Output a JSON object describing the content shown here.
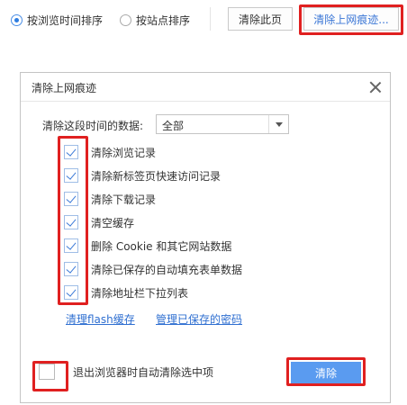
{
  "toolbar": {
    "sort_by_time": "按浏览时间排序",
    "sort_by_site": "按站点排序",
    "clear_page_button": "清除此页",
    "clear_history_button": "清除上网痕迹..."
  },
  "dialog": {
    "title": "清除上网痕迹",
    "range_label": "清除这段时间的数据:",
    "range_selected": "全部",
    "options": [
      {
        "label": "清除浏览记录",
        "checked": true
      },
      {
        "label": "清除新标签页快速访问记录",
        "checked": true
      },
      {
        "label": "清除下载记录",
        "checked": true
      },
      {
        "label": "清空缓存",
        "checked": true
      },
      {
        "label": "删除 Cookie 和其它网站数据",
        "checked": true
      },
      {
        "label": "清除已保存的自动填充表单数据",
        "checked": true
      },
      {
        "label": "清除地址栏下拉列表",
        "checked": true
      }
    ],
    "links": {
      "flash": "清理flash缓存",
      "passwords": "管理已保存的密码"
    },
    "auto_clear_label": "退出浏览器时自动清除选中项",
    "auto_clear_checked": false,
    "clear_button": "清除"
  },
  "colors": {
    "accent": "#2d7de0",
    "button_primary": "#5a9bf0",
    "annotation": "#e02020",
    "link": "#2f6fd1"
  }
}
